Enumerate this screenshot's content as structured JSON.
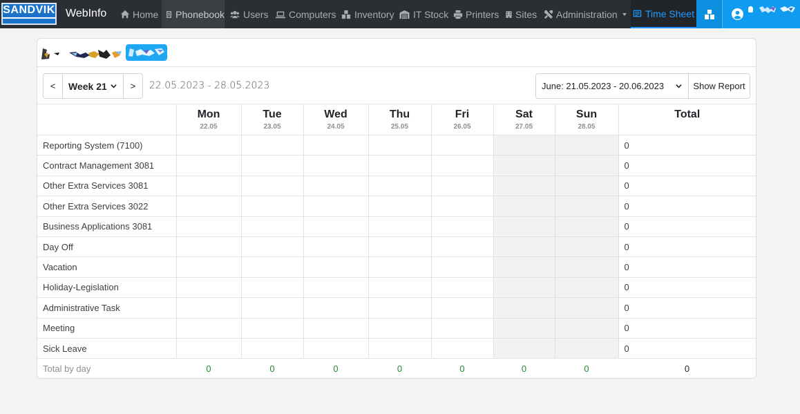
{
  "navbar": {
    "logo_text": "SANDVIK",
    "brand": "WebInfo",
    "items": [
      {
        "label": "Home",
        "icon": "home-icon"
      },
      {
        "label": "Phonebook",
        "icon": "phonebook-icon"
      },
      {
        "label": "Users",
        "icon": "users-icon"
      },
      {
        "label": "Computers",
        "icon": "computer-icon"
      },
      {
        "label": "Inventory",
        "icon": "inventory-icon"
      },
      {
        "label": "IT Stock",
        "icon": "warehouse-icon"
      },
      {
        "label": "Printers",
        "icon": "printer-icon"
      },
      {
        "label": "Sites",
        "icon": "building-icon"
      },
      {
        "label": "Administration",
        "icon": "tools-icon"
      }
    ],
    "active_tab": "Time Sheet"
  },
  "toolbar": {
    "prev_label": "<",
    "week_label": "Week 21",
    "next_label": ">",
    "date_range": "22.05.2023 - 28.05.2023",
    "report_period": "June: 21.05.2023 - 20.06.2023",
    "show_report_label": "Show Report"
  },
  "table": {
    "days": [
      {
        "name": "Mon",
        "date": "22.05"
      },
      {
        "name": "Tue",
        "date": "23.05"
      },
      {
        "name": "Wed",
        "date": "24.05"
      },
      {
        "name": "Thu",
        "date": "25.05"
      },
      {
        "name": "Fri",
        "date": "26.05"
      },
      {
        "name": "Sat",
        "date": "27.05"
      },
      {
        "name": "Sun",
        "date": "28.05"
      }
    ],
    "total_header": "Total",
    "rows": [
      {
        "project": "Reporting System (7100)",
        "total": "0"
      },
      {
        "project": "Contract Management 3081",
        "total": "0"
      },
      {
        "project": "Other Extra Services 3081",
        "total": "0"
      },
      {
        "project": "Other Extra Services 3022",
        "total": "0"
      },
      {
        "project": "Business Applications 3081",
        "total": "0"
      },
      {
        "project": "Day Off",
        "total": "0"
      },
      {
        "project": "Vacation",
        "total": "0"
      },
      {
        "project": "Holiday-Legislation",
        "total": "0"
      },
      {
        "project": "Administrative Task",
        "total": "0"
      },
      {
        "project": "Meeting",
        "total": "0"
      },
      {
        "project": "Sick Leave",
        "total": "0"
      }
    ],
    "totals_label": "Total by day",
    "day_totals": [
      "0",
      "0",
      "0",
      "0",
      "0",
      "0",
      "0"
    ],
    "grand_total": "0"
  },
  "colors": {
    "navbar_bg": "#2b2f33",
    "accent_blue": "#0f9bf0",
    "total_green": "#1e8c2e",
    "weekend_bg": "#f2f2f2"
  }
}
